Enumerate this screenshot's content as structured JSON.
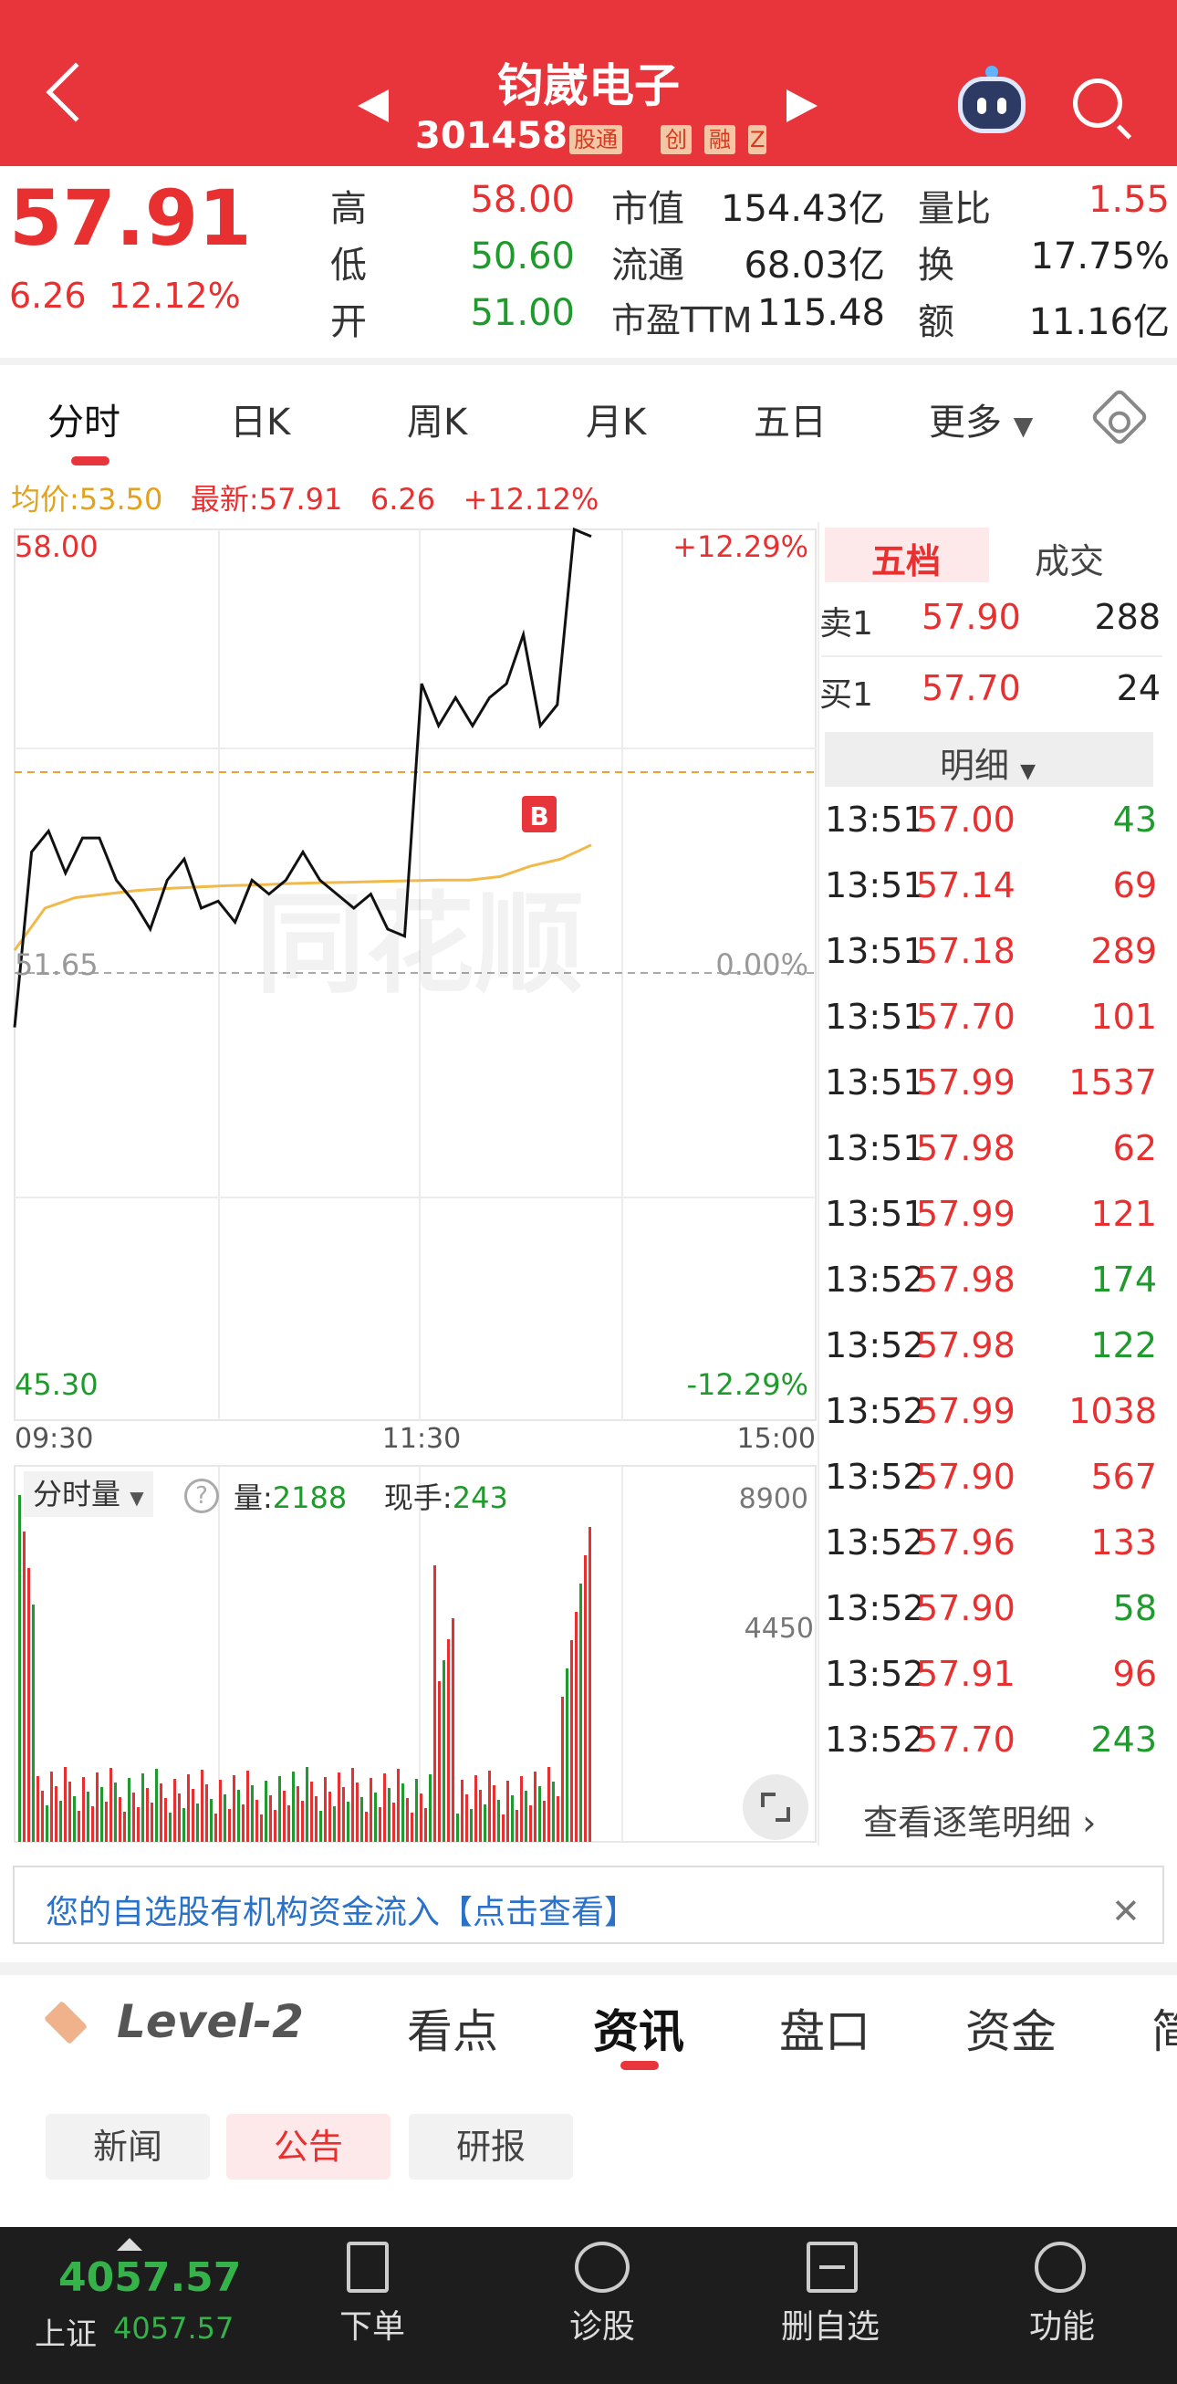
{
  "header": {
    "name": "钧崴电子",
    "code": "301458",
    "tags": [
      "股通",
      "创",
      "融",
      "Z"
    ]
  },
  "quote": {
    "price": "57.91",
    "change": "6.26",
    "change_pct": "12.12%",
    "cells": [
      {
        "label": "高",
        "value": "58.00"
      },
      {
        "label": "低",
        "value": "50.60"
      },
      {
        "label": "开",
        "value": "51.00"
      },
      {
        "label": "市值",
        "value": "154.43亿"
      },
      {
        "label": "流通",
        "value": "68.03亿"
      },
      {
        "label": "市盈TTM",
        "value": "115.48"
      },
      {
        "label": "量比",
        "value": "1.55"
      },
      {
        "label": "换",
        "value": "17.75%"
      },
      {
        "label": "额",
        "value": "11.16亿"
      }
    ]
  },
  "tabs": [
    "分时",
    "日K",
    "周K",
    "月K",
    "五日",
    "更多"
  ],
  "info_line": {
    "avg": "均价:53.50",
    "latest": "最新:57.91",
    "chg": "6.26",
    "pct": "+12.12%"
  },
  "chart": {
    "y_top": "58.00",
    "y_mid": "51.65",
    "y_bottom": "45.30",
    "pct_top": "+12.29%",
    "pct_mid": "0.00%",
    "pct_bottom": "-12.29%",
    "x_labels": [
      "09:30",
      "11:30",
      "15:00"
    ],
    "marker": "B",
    "watermark": "同花顺"
  },
  "chart_data": {
    "type": "line",
    "series": [
      {
        "values": [
          50.9,
          53.4,
          53.7,
          53.1,
          53.6,
          53.6,
          53.0,
          52.7,
          52.3,
          53.0,
          53.3,
          52.6,
          52.7,
          52.4,
          53.0,
          52.8,
          53.0,
          53.4,
          53.0,
          52.8,
          52.6,
          52.8,
          52.3,
          52.2,
          55.8,
          55.2,
          55.6,
          55.2,
          55.6,
          55.8,
          56.5,
          55.2,
          55.5,
          58.0,
          57.9
        ]
      },
      {
        "values": [
          52.0,
          52.6,
          52.75,
          52.8,
          52.85,
          52.88,
          52.9,
          52.92,
          52.93,
          52.95,
          52.96,
          52.97,
          52.98,
          52.99,
          53.0,
          53.0,
          53.05,
          53.2,
          53.3,
          53.5
        ]
      }
    ],
    "ylim": [
      45.3,
      58.0
    ]
  },
  "volume": {
    "label": "分时量",
    "vol_label": "量:",
    "vol": "2188",
    "hand_label": "现手:",
    "hand": "243",
    "max": "8900",
    "mid": "4450"
  },
  "orderbook": {
    "tabs": [
      "五档",
      "成交"
    ],
    "sell1": {
      "label": "卖1",
      "price": "57.90",
      "vol": "288"
    },
    "buy1": {
      "label": "买1",
      "price": "57.70",
      "vol": "24"
    },
    "detail_label": "明细",
    "ticks": [
      {
        "t": "13:51",
        "p": "57.00",
        "v": "43",
        "c": "green"
      },
      {
        "t": "13:51",
        "p": "57.14",
        "v": "69",
        "c": "red"
      },
      {
        "t": "13:51",
        "p": "57.18",
        "v": "289",
        "c": "red"
      },
      {
        "t": "13:51",
        "p": "57.70",
        "v": "101",
        "c": "red"
      },
      {
        "t": "13:51",
        "p": "57.99",
        "v": "1537",
        "c": "red"
      },
      {
        "t": "13:51",
        "p": "57.98",
        "v": "62",
        "c": "red"
      },
      {
        "t": "13:51",
        "p": "57.99",
        "v": "121",
        "c": "red"
      },
      {
        "t": "13:52",
        "p": "57.98",
        "v": "174",
        "c": "green"
      },
      {
        "t": "13:52",
        "p": "57.98",
        "v": "122",
        "c": "green"
      },
      {
        "t": "13:52",
        "p": "57.99",
        "v": "1038",
        "c": "red"
      },
      {
        "t": "13:52",
        "p": "57.90",
        "v": "567",
        "c": "red"
      },
      {
        "t": "13:52",
        "p": "57.96",
        "v": "133",
        "c": "red"
      },
      {
        "t": "13:52",
        "p": "57.90",
        "v": "58",
        "c": "green"
      },
      {
        "t": "13:52",
        "p": "57.91",
        "v": "96",
        "c": "red"
      },
      {
        "t": "13:52",
        "p": "57.70",
        "v": "243",
        "c": "green"
      }
    ],
    "view_all": "查看逐笔明细"
  },
  "banner": {
    "text": "您的自选股有机构资金流入【点击查看】"
  },
  "sub_tabs": [
    "Level-2",
    "看点",
    "资讯",
    "盘口",
    "资金",
    "简"
  ],
  "chips": [
    "新闻",
    "公告",
    "研报"
  ],
  "bottom_bar": {
    "index_value": "4057.57",
    "index_name": "上证",
    "index_small": "4057.57",
    "items": [
      "下单",
      "诊股",
      "删自选",
      "功能"
    ]
  },
  "colors": {
    "brand_red": "#e8353b",
    "up": "#e93030",
    "down": "#1f9a2c",
    "avg_line": "#f0b94a"
  }
}
